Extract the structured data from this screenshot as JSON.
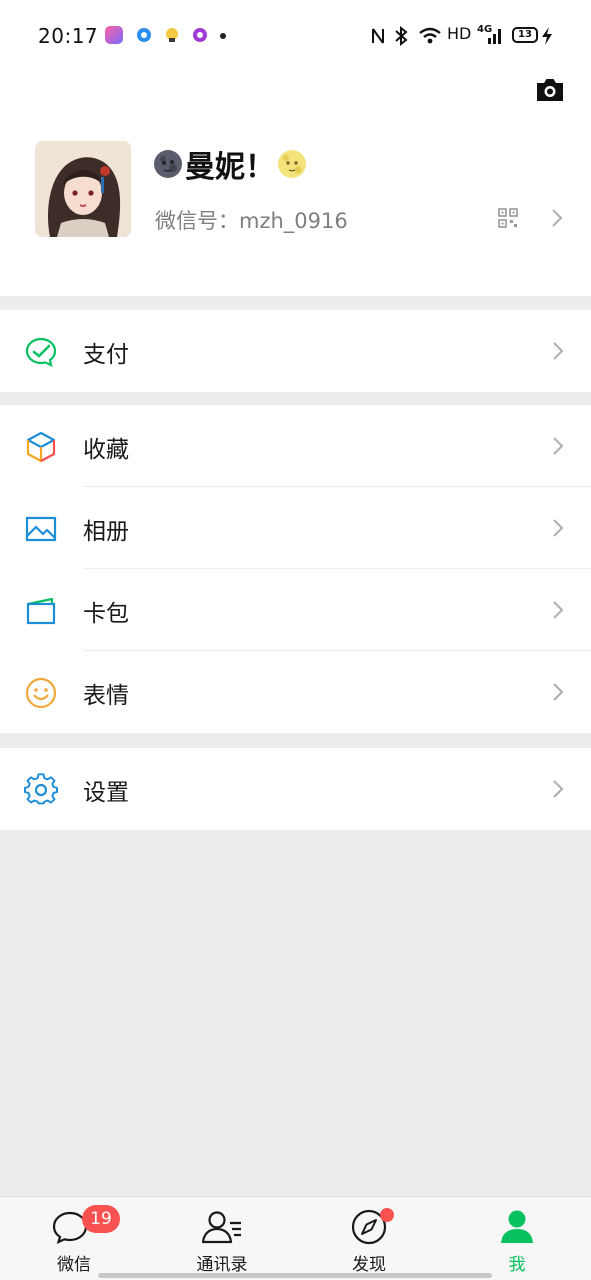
{
  "status_bar": {
    "time": "20:17",
    "right_text": "HD",
    "network_label": "4G",
    "battery": "13",
    "app_icons": [
      "app-icon-pink",
      "app-icon-blue",
      "app-icon-yellow",
      "app-icon-purple"
    ]
  },
  "profile": {
    "nickname": "曼妮！",
    "wechat_id": "微信号：mzh_0916",
    "left_emoji": "new-moon-face-emoji",
    "right_emoji": "full-moon-face-emoji"
  },
  "menu_groups": [
    {
      "items": [
        {
          "label": "支付",
          "icon": "pay-icon",
          "color": "#07c160"
        }
      ]
    },
    {
      "items": [
        {
          "label": "收藏",
          "icon": "favorites-cube-icon",
          "color": "#f5a623"
        },
        {
          "label": "相册",
          "icon": "album-icon",
          "color": "#1e8ed8"
        },
        {
          "label": "卡包",
          "icon": "card-wallet-icon",
          "color": "#1e8ed8"
        },
        {
          "label": "表情",
          "icon": "smiley-icon",
          "color": "#f0a93b"
        }
      ]
    },
    {
      "items": [
        {
          "label": "设置",
          "icon": "gear-icon",
          "color": "#1e8ed8"
        }
      ]
    }
  ],
  "tabbar": {
    "tabs": [
      {
        "label": "微信",
        "icon": "chat-bubble-icon",
        "badge": "19"
      },
      {
        "label": "通讯录",
        "icon": "contacts-icon"
      },
      {
        "label": "发现",
        "icon": "compass-icon",
        "dot": true
      },
      {
        "label": "我",
        "icon": "me-person-icon",
        "active": true
      }
    ]
  },
  "colors": {
    "accent": "#07c160",
    "badge": "#fa5151",
    "background": "#ededed"
  }
}
